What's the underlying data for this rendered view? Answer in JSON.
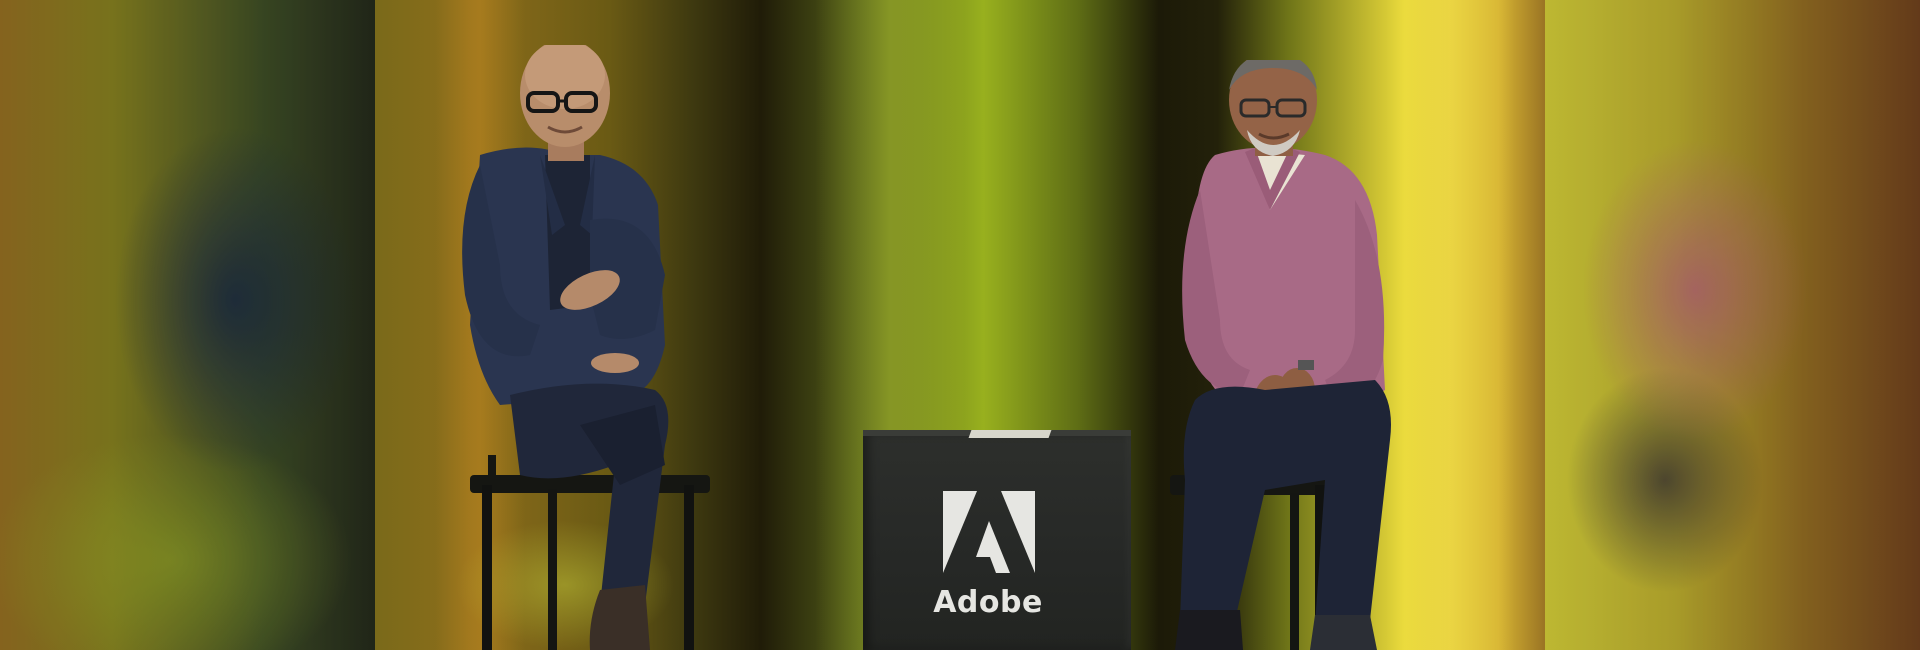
{
  "scene": {
    "description_colors": {
      "backdrop_left": "#8c6d1b",
      "backdrop_center": "#98b01e",
      "backdrop_right": "#e9d93a"
    }
  },
  "podium": {
    "brand_name": "Adobe",
    "logo_icon": "adobe-logo-icon",
    "color": "#2a2c29"
  },
  "people": [
    {
      "position": "left",
      "jacket_color": "#2a3550",
      "pants_color": "#20273a"
    },
    {
      "position": "right",
      "sweater_color": "#a86a86",
      "pants_color": "#1e2436"
    }
  ]
}
